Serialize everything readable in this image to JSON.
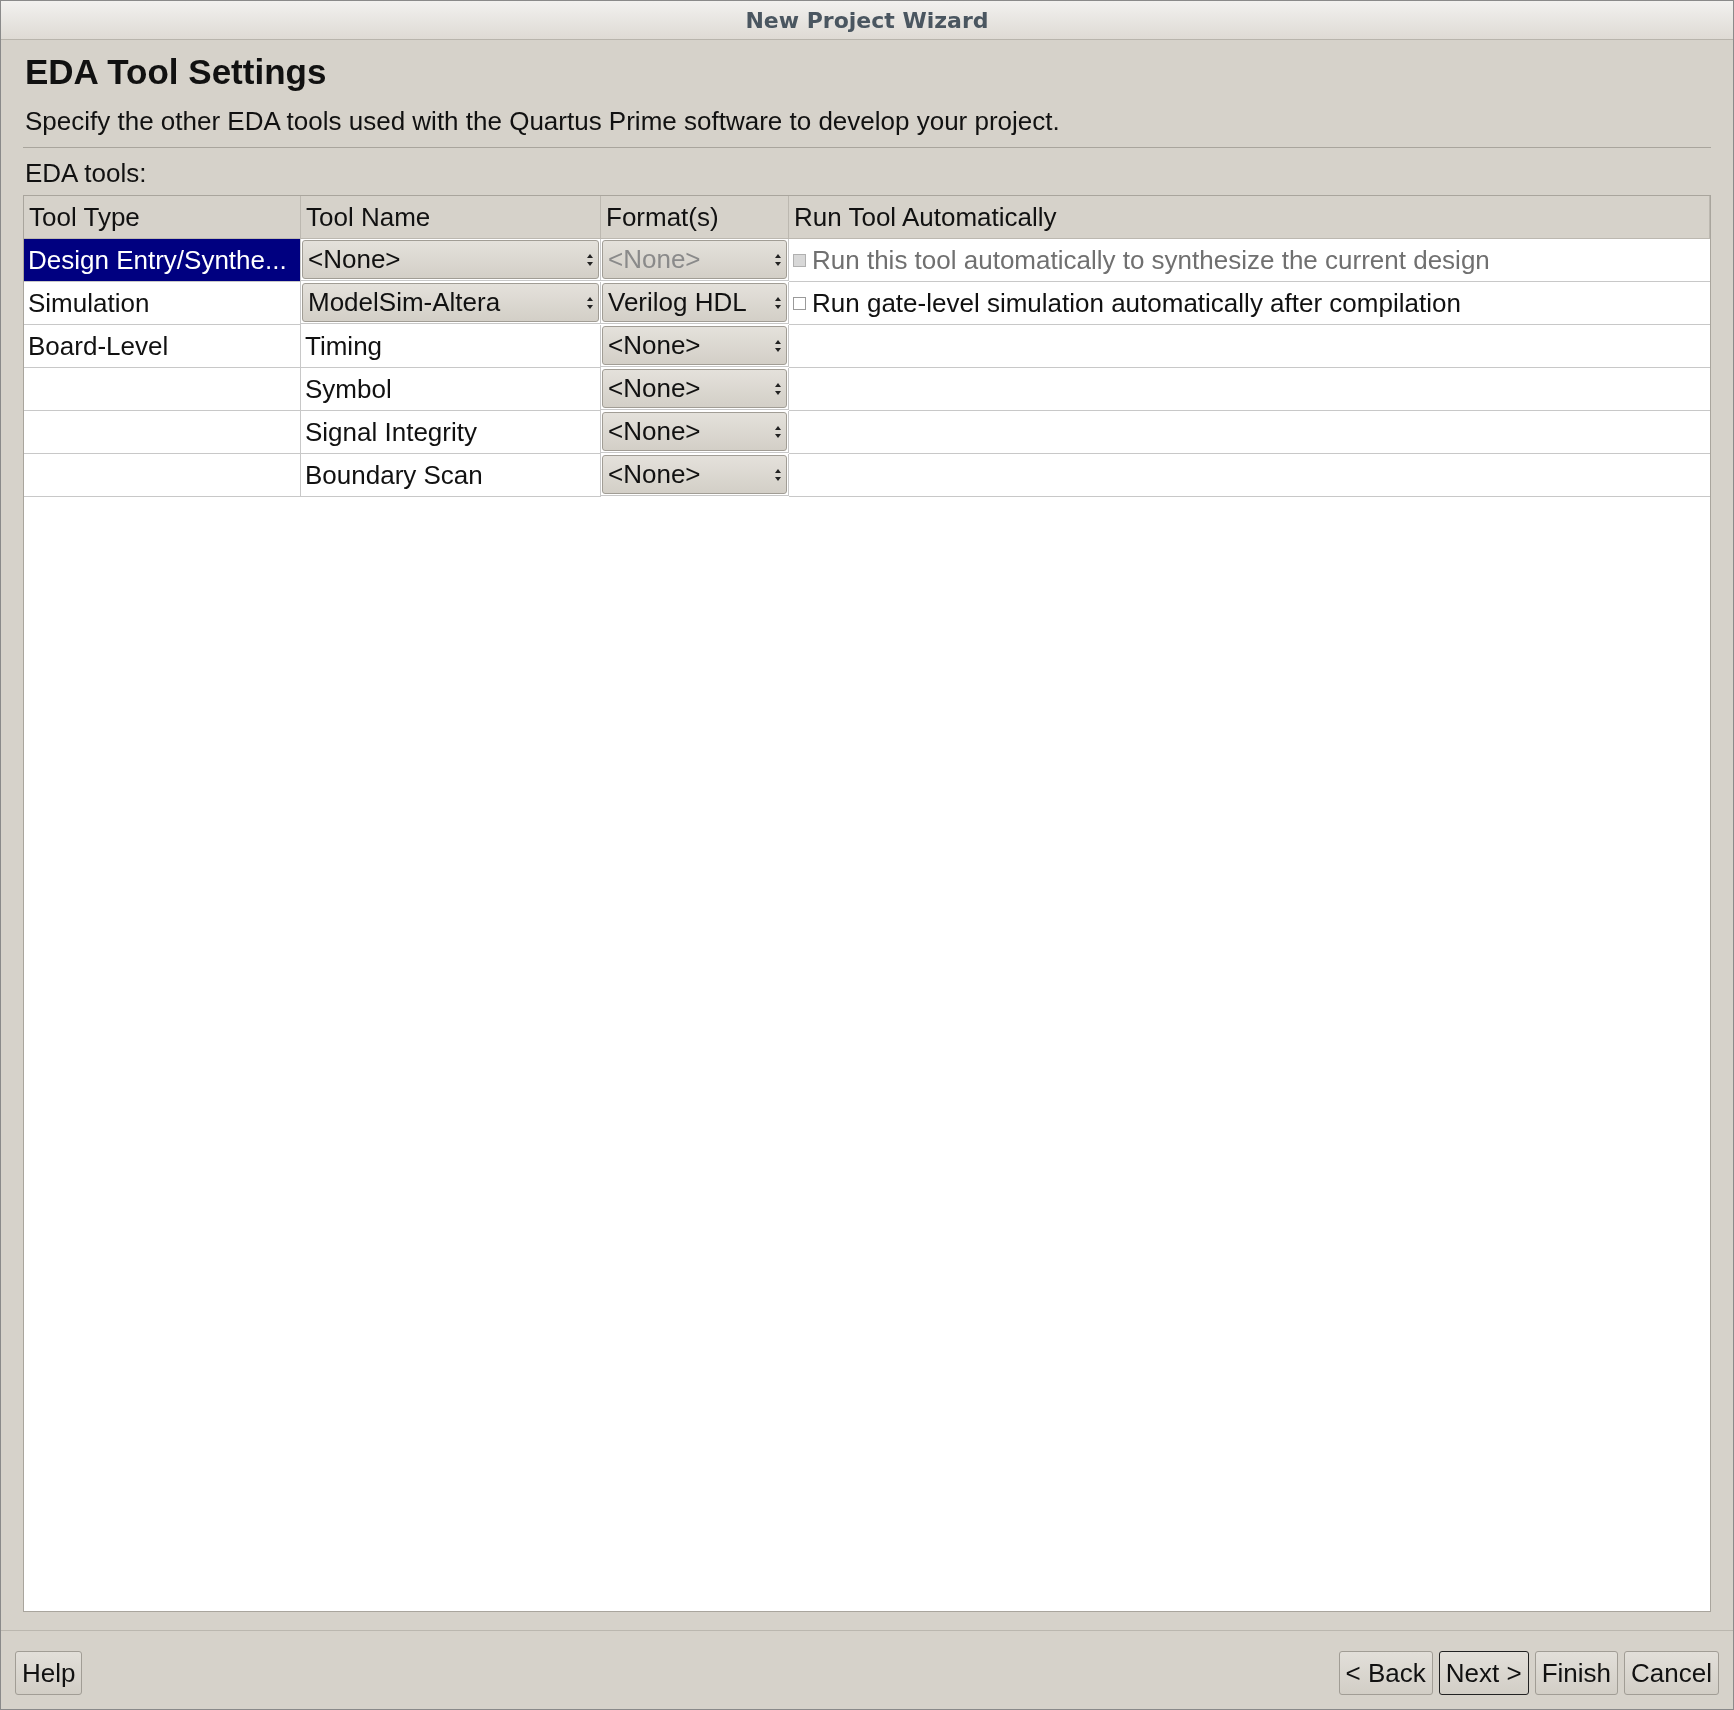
{
  "window": {
    "title": "New Project Wizard"
  },
  "page": {
    "heading": "EDA Tool Settings",
    "description": "Specify the other EDA tools used with the Quartus Prime software to develop your project."
  },
  "table": {
    "label": "EDA tools:",
    "columns": [
      "Tool Type",
      "Tool Name",
      "Format(s)",
      "Run Tool Automatically"
    ],
    "rows": [
      {
        "selected": true,
        "tool_type": "Design Entry/Synthe...",
        "tool_name": {
          "kind": "combo",
          "value": "<None>",
          "disabled": false
        },
        "format": {
          "value": "<None>",
          "disabled": true
        },
        "run": {
          "label": "Run this tool automatically to synthesize the current design",
          "checked": false,
          "disabled": true
        }
      },
      {
        "selected": false,
        "tool_type": "Simulation",
        "tool_name": {
          "kind": "combo",
          "value": "ModelSim-Altera",
          "disabled": false
        },
        "format": {
          "value": "Verilog HDL",
          "disabled": false
        },
        "run": {
          "label": "Run gate-level simulation automatically after compilation",
          "checked": false,
          "disabled": false
        }
      },
      {
        "selected": false,
        "tool_type": "Board-Level",
        "tool_name": {
          "kind": "text",
          "value": "Timing"
        },
        "format": {
          "value": "<None>",
          "disabled": false
        }
      },
      {
        "selected": false,
        "tool_name": {
          "kind": "text",
          "value": "Symbol"
        },
        "format": {
          "value": "<None>",
          "disabled": false
        }
      },
      {
        "selected": false,
        "tool_name": {
          "kind": "text",
          "value": "Signal Integrity"
        },
        "format": {
          "value": "<None>",
          "disabled": false
        }
      },
      {
        "selected": false,
        "tool_name": {
          "kind": "text",
          "value": "Boundary Scan"
        },
        "format": {
          "value": "<None>",
          "disabled": false
        }
      }
    ]
  },
  "buttons_left": [
    {
      "label": "Help",
      "default": false
    }
  ],
  "buttons_right": [
    {
      "label": "< Back",
      "default": false
    },
    {
      "label": "Next >",
      "default": true
    },
    {
      "label": "Finish",
      "default": false
    },
    {
      "label": "Cancel",
      "default": false
    }
  ]
}
